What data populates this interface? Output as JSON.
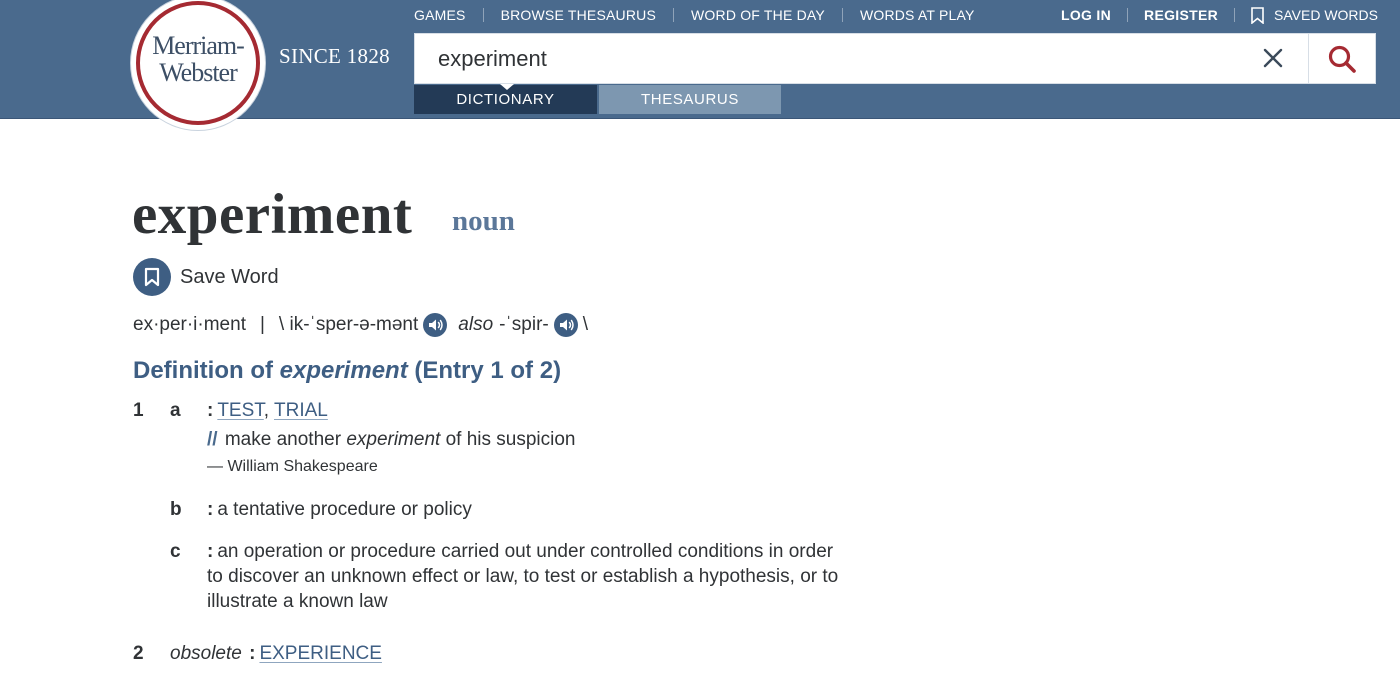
{
  "header": {
    "logo": {
      "line1": "Merriam-",
      "line2": "Webster"
    },
    "since": "SINCE 1828",
    "nav": [
      "GAMES",
      "BROWSE THESAURUS",
      "WORD OF THE DAY",
      "WORDS AT PLAY"
    ],
    "login": "LOG IN",
    "register": "REGISTER",
    "saved_words": "SAVED WORDS",
    "search": {
      "value": "experiment"
    },
    "tabs": {
      "dictionary": "DICTIONARY",
      "thesaurus": "THESAURUS"
    }
  },
  "entry": {
    "headword": "experiment",
    "part_of_speech": "noun",
    "save_word": "Save Word",
    "syllables": "ex·per·i·ment",
    "separator": "|",
    "pron_open": "\\ ik-ˈsper-ə-mənt",
    "also": "also",
    "pron_alt": "-ˈspir-",
    "pron_close": "\\",
    "definition_heading": {
      "prefix": "Definition of",
      "word": "experiment",
      "suffix": "(Entry 1 of 2)"
    },
    "senses": {
      "1": {
        "num": "1",
        "a": {
          "letter": "a",
          "colon": ":",
          "xref1": "TEST",
          "comma": ",",
          "xref2": "TRIAL",
          "example_slashes": "//",
          "example_pre": "make another",
          "example_word": "experiment",
          "example_post": "of his suspicion",
          "attribution": "— William Shakespeare"
        },
        "b": {
          "letter": "b",
          "colon": ":",
          "text": "a tentative procedure or policy"
        },
        "c": {
          "letter": "c",
          "colon": ":",
          "line1": "an operation or procedure carried out under controlled conditions in order",
          "line2": "to discover an unknown effect or law, to test or establish a hypothesis, or to",
          "line3": "illustrate a known law"
        }
      },
      "2": {
        "num": "2",
        "label": "obsolete",
        "colon": ":",
        "xref": "EXPERIENCE"
      }
    }
  },
  "colors": {
    "header_bg": "#4a6a8d",
    "logo_ring": "#a52a32",
    "tab_active": "#233a56",
    "tab_inactive": "#7d97b0",
    "accent_blue": "#3e5e83",
    "search_icon": "#a52a32"
  },
  "icons": [
    "clear-icon",
    "search-icon",
    "bookmark-icon",
    "audio-icon"
  ]
}
